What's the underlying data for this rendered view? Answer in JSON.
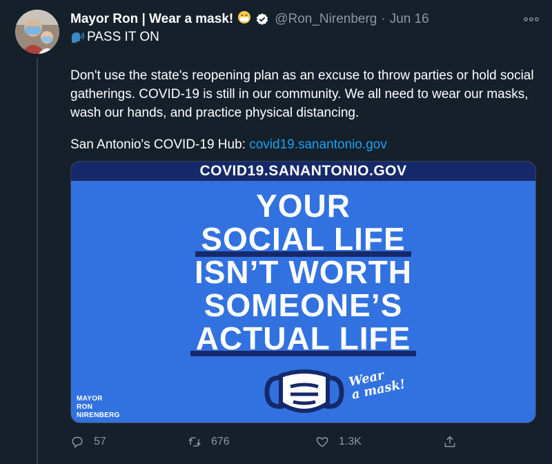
{
  "tweet": {
    "display_name": "Mayor Ron | Wear a mask!",
    "handle": "@Ron_Nirenberg",
    "separator": "·",
    "date": "Jun 16",
    "first_line": "PASS IT ON",
    "body": "Don't use the state's reopening plan as an excuse to throw parties or hold social gatherings. COVID-19 is still in our community. We all need to wear our masks, wash our hands, and practice physical distancing.",
    "hub_label": "San Antonio's COVID-19 Hub: ",
    "hub_link": "covid19.sanantonio.gov"
  },
  "card": {
    "banner": "COVID19.SANANTONIO.GOV",
    "headline": [
      "YOUR",
      "SOCIAL LIFE",
      "ISN’T WORTH",
      "SOMEONE’S",
      "ACTUAL LIFE"
    ],
    "wear_line1": "Wear",
    "wear_line2": "a mask!",
    "brand_line1": "MAYOR",
    "brand_line2": "RON",
    "brand_line3": "NIRENBERG",
    "colors": {
      "background": "#3272e0",
      "navy": "#16296a"
    }
  },
  "actions": {
    "replies": "57",
    "retweets": "676",
    "likes": "1.3K"
  },
  "icons": [
    "face-with-mask-emoji-icon",
    "verified-badge-icon",
    "more-icon",
    "speaking-head-icon",
    "reply-icon",
    "retweet-icon",
    "like-icon",
    "share-icon",
    "face-mask-icon"
  ],
  "theme": {
    "background": "#15202b",
    "muted": "#8899a6",
    "link": "#1da1f2"
  }
}
